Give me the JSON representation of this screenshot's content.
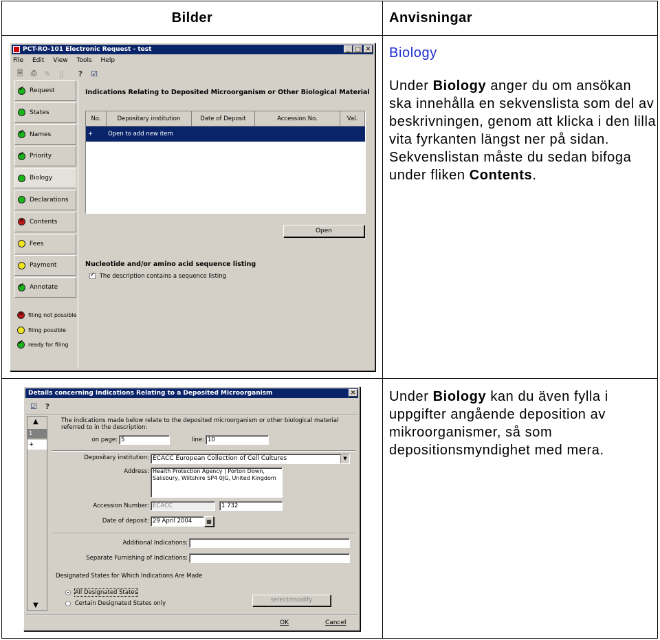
{
  "header": {
    "col_images": "Bilder",
    "col_instructions": "Anvisningar"
  },
  "row1": {
    "instruction": {
      "title": "Biology",
      "p1_a": "Under ",
      "p1_b": "Biology",
      "p1_c": " anger du om ansökan ska innehålla en sekvenslista som del av beskrivningen, genom att klicka i den lilla vita fyrkanten längst ner på sidan. Sekvenslistan måste du sedan bifoga under fliken ",
      "p1_d": "Contents",
      "p1_e": "."
    },
    "window": {
      "title": "PCT-RO-101 Electronic Request - test",
      "menu": [
        "File",
        "Edit",
        "View",
        "Tools",
        "Help"
      ],
      "sidebar": [
        {
          "label": "Request",
          "status": "green-check"
        },
        {
          "label": "States",
          "status": "green"
        },
        {
          "label": "Names",
          "status": "green-check"
        },
        {
          "label": "Priority",
          "status": "green-check"
        },
        {
          "label": "Biology",
          "status": "green",
          "active": true
        },
        {
          "label": "Declarations",
          "status": "green"
        },
        {
          "label": "Contents",
          "status": "red-cross"
        },
        {
          "label": "Fees",
          "status": "yellow"
        },
        {
          "label": "Payment",
          "status": "yellow"
        },
        {
          "label": "Annotate",
          "status": "green-check"
        }
      ],
      "legend": [
        {
          "label": "filing not possible",
          "status": "red-cross"
        },
        {
          "label": "filing possible",
          "status": "yellow"
        },
        {
          "label": "ready for filing",
          "status": "green-check"
        }
      ],
      "panel_title": "Indications Relating to Deposited Microorganism or Other Biological Material",
      "grid_headers": [
        "No.",
        "Depositary institution",
        "Date of Deposit",
        "Accession No.",
        "Val."
      ],
      "grid_row": {
        "marker": "+",
        "text": "Open to add new item"
      },
      "open_button": "Open",
      "seq_title": "Nucleotide and/or amino acid sequence listing",
      "seq_checkbox": "The description contains a sequence listing"
    }
  },
  "row2": {
    "instruction": {
      "p_a": "Under ",
      "p_b": "Biology",
      "p_c": " kan du även fylla i uppgifter angående deposition av mikroorganismer, så som depositionsmyndighet med mera."
    },
    "dialog": {
      "title": "Details concerning Indications Relating to a Deposited Microorganism",
      "left_list": [
        "1",
        "+"
      ],
      "intro": "The indications made below relate to the deposited microorganism or other biological material referred to in the description:",
      "on_page_label": "on page:",
      "on_page_value": "5",
      "line_label": "line:",
      "line_value": "10",
      "depositary_label": "Depositary institution:",
      "depositary_value": "ECACC European Collection of Cell Cultures",
      "address_label": "Address:",
      "address_value": "Health Protection Agency | Porton Down, Salisbury, Wiltshire SP4 0JG, United Kingdom",
      "accession_label": "Accession Number:",
      "accession_prefix": "ECACC",
      "accession_value": "1 732",
      "date_label": "Date of deposit:",
      "date_value": "29 April 2004",
      "additional_label": "Additional Indications:",
      "separate_label": "Separate Furnishing of Indications:",
      "designated_label": "Designated States for Which Indications Are Made",
      "radio_all": "All Designated States",
      "radio_certain": "Certain Designated States only",
      "select_button": "select/modify",
      "ok_button": "OK",
      "cancel_button": "Cancel"
    }
  }
}
